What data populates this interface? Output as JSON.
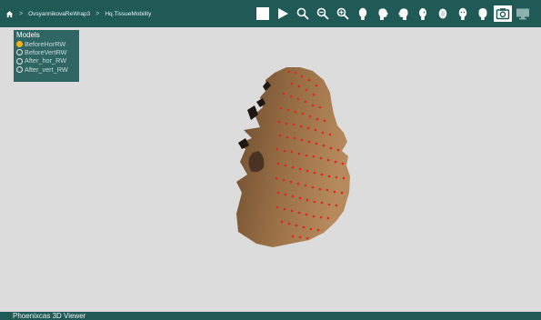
{
  "toolbar": {
    "home_icon": "home-icon",
    "breadcrumb": [
      "OvsyannikovaReWrap3",
      "Hq.TissueMobility"
    ],
    "separator": ">",
    "tools": [
      "stop-icon",
      "play-icon",
      "zoom-icon",
      "zoom-out-icon",
      "zoom-in-icon",
      "head-front-icon",
      "head-side-icon",
      "head-back-icon",
      "head-quarter-icon",
      "head-top-icon",
      "head-left-icon",
      "head-right-icon",
      "camera-icon",
      "monitor-icon"
    ]
  },
  "models_panel": {
    "title": "Models",
    "items": [
      {
        "label": "BeforeHorRW",
        "selected": true
      },
      {
        "label": "BeforeVertRW",
        "selected": false
      },
      {
        "label": "After_hor_RW",
        "selected": false
      },
      {
        "label": "After_vert_RW",
        "selected": false
      }
    ]
  },
  "status": {
    "label": "Phoenixcas 3D Viewer"
  },
  "colors": {
    "accent": "#205a57",
    "viewport_bg": "#dcdcdc",
    "selected_radio": "#f2b31a",
    "marker": "#e0261b"
  }
}
